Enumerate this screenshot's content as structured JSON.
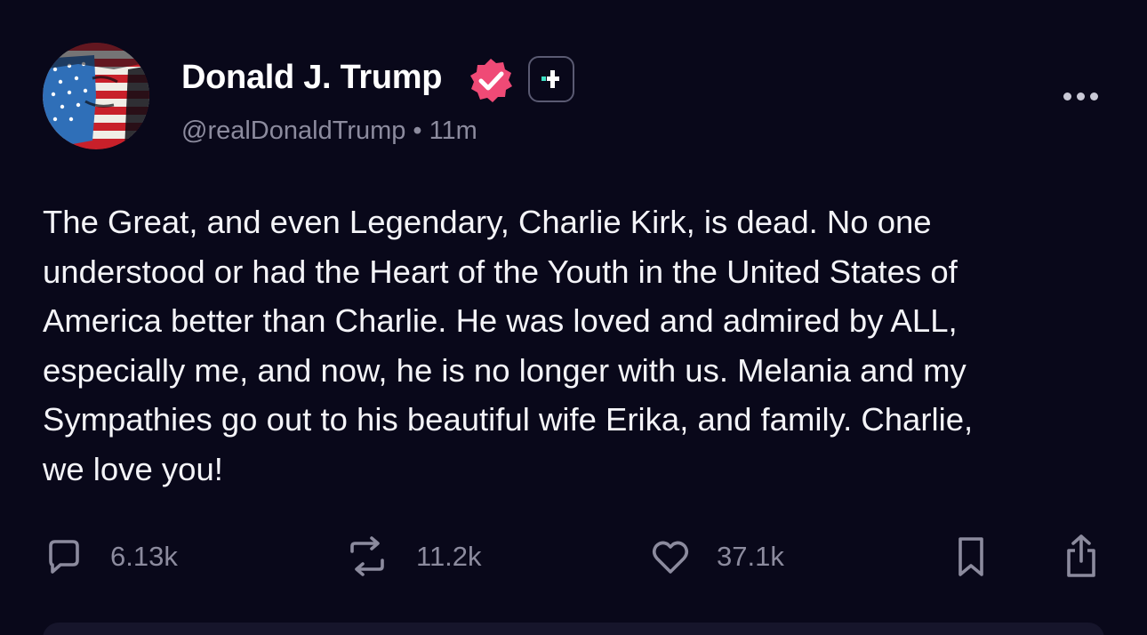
{
  "post": {
    "author": {
      "display_name": "Donald J. Trump",
      "handle": "@realDonaldTrump",
      "verified_icon": "verified-badge-icon",
      "plus_badge_icon": "plus-badge-icon"
    },
    "separator": "•",
    "timestamp": "11m",
    "text": "The Great, and even Legendary, Charlie Kirk, is dead. No one\nunderstood or had the Heart of the Youth in the United States of\nAmerica better than Charlie. He was loved and admired by ALL,\nespecially me, and now, he is no longer with us. Melania and my\nSympathies go out to his beautiful wife Erika, and family. Charlie,\nwe love you!",
    "actions": {
      "replies": "6.13k",
      "reposts": "11.2k",
      "likes": "37.1k",
      "icons": [
        "comment-icon",
        "repost-icon",
        "heart-icon",
        "bookmark-icon",
        "share-icon"
      ]
    },
    "colors": {
      "background": "#09081a",
      "verified": "#ef4a76",
      "plus_accent": "#3fe0c5",
      "muted_text": "#8c8b9e"
    }
  }
}
